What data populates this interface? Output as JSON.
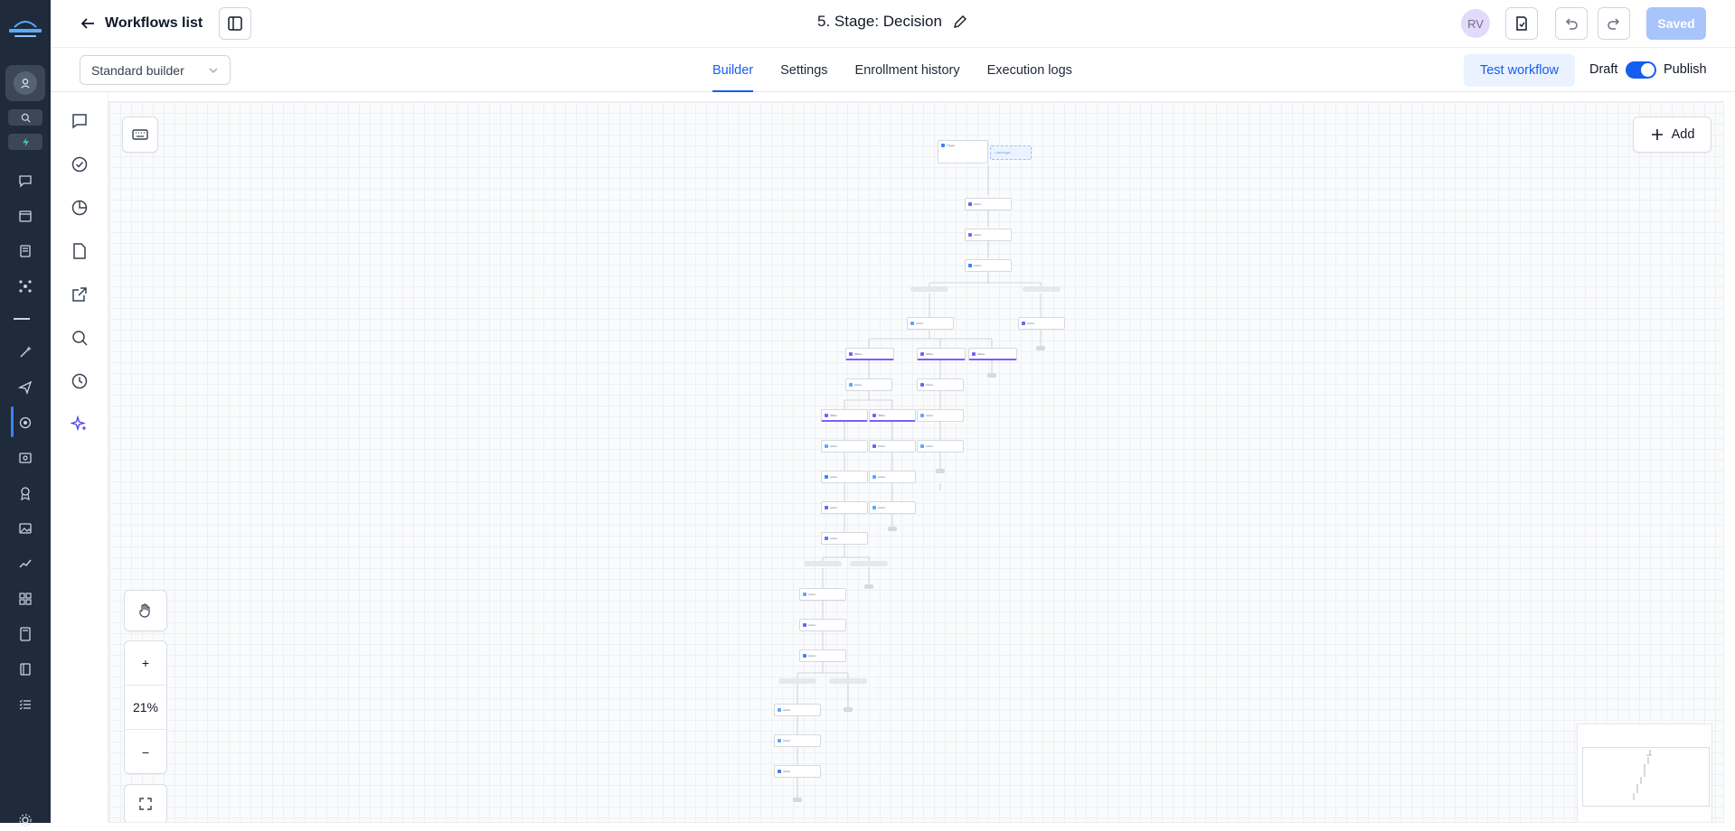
{
  "header": {
    "back_label": "Workflows list",
    "workflow_title": "5. Stage: Decision",
    "avatar_initials": "RV",
    "saved_label": "Saved"
  },
  "subbar": {
    "builder_mode": "Standard builder",
    "tabs": [
      {
        "label": "Builder",
        "active": true
      },
      {
        "label": "Settings",
        "active": false
      },
      {
        "label": "Enrollment history",
        "active": false
      },
      {
        "label": "Execution logs",
        "active": false
      }
    ],
    "test_label": "Test workflow",
    "draft_label": "Draft",
    "publish_label": "Publish",
    "publish_toggle_on": true
  },
  "canvas": {
    "add_label": "Add",
    "zoom_level": "21%",
    "zoom_in": "+",
    "zoom_out": "−"
  },
  "colors": {
    "rail_bg": "#1f2b3b",
    "accent": "#155eef",
    "saved_btn": "#a8c4fb",
    "branch_condition": "#7c5cff"
  },
  "icons": {
    "rail": [
      "account-icon",
      "search-icon",
      "lightning-icon",
      "chat-icon",
      "calendar-icon",
      "contacts-icon",
      "network-icon",
      "magic-icon",
      "send-icon",
      "automation-icon",
      "payments-icon",
      "award-icon",
      "media-icon",
      "trend-icon",
      "apps-icon",
      "calculator-icon",
      "book-icon",
      "list-icon",
      "settings-icon"
    ],
    "secondary": [
      "comment-icon",
      "check-circle-icon",
      "pie-chart-icon",
      "file-icon",
      "external-link-icon",
      "search-icon",
      "history-icon",
      "ai-sparkle-icon"
    ]
  }
}
